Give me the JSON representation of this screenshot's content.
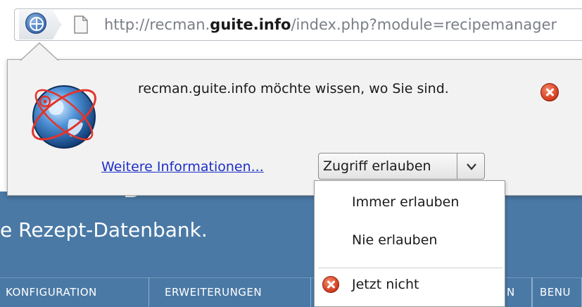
{
  "urlbar": {
    "url_prefix": "http://recman.",
    "url_host": "guite.info",
    "url_path": "/index.php?module=recipemanager"
  },
  "page": {
    "subtitle": "e Rezept-Datenbank.",
    "nav_items": [
      "KONFIGURATION",
      "ERWEITERUNGEN",
      "N",
      "BENU"
    ]
  },
  "notification": {
    "message": "recman.guite.info möchte wissen, wo Sie sind.",
    "more_info_link": "Weitere Informationen...",
    "allow_button": "Zugriff erlauben",
    "menu": {
      "always_allow": "Immer erlauben",
      "never_allow": "Nie erlauben",
      "not_now": "Jetzt nicht"
    }
  },
  "icons": {
    "site_identity": "site-identity-icon",
    "page": "page-icon",
    "geolocation": "globe-icon",
    "close": "close-icon",
    "dropdown": "chevron-down-icon"
  },
  "colors": {
    "banner": "#4a79a5",
    "link": "#1d2fc8",
    "close_red": "#d2391c"
  }
}
